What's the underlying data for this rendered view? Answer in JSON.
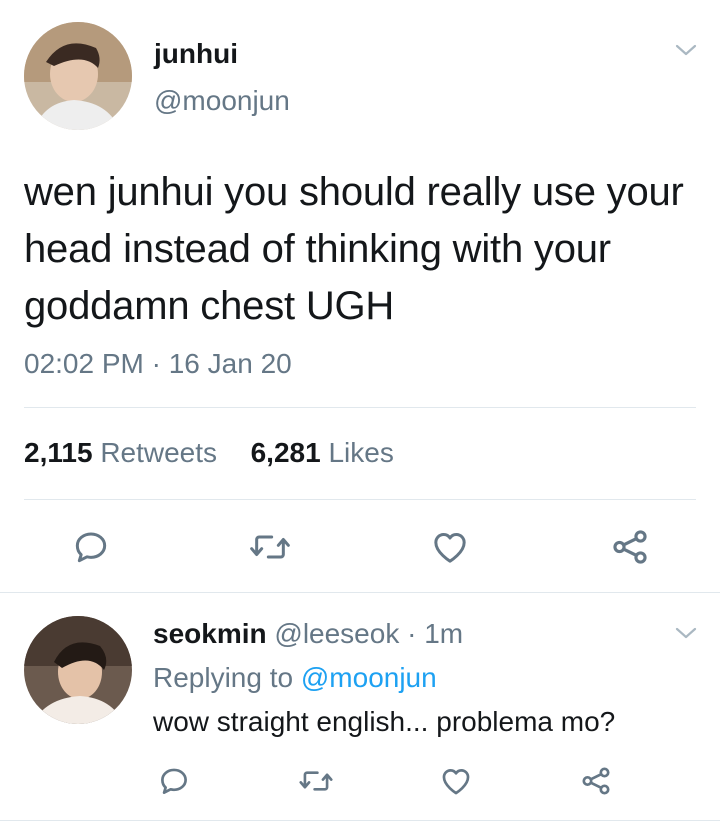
{
  "main_tweet": {
    "display_name": "junhui",
    "handle": "@moonjun",
    "text": "wen junhui you should really use your head instead of thinking with your goddamn chest UGH",
    "timestamp": "02:02 PM · 16 Jan 20",
    "retweets_count": "2,115",
    "retweets_label": "Retweets",
    "likes_count": "6,281",
    "likes_label": "Likes"
  },
  "reply": {
    "display_name": "seokmin",
    "handle": "@leeseok",
    "time": "· 1m",
    "replying_prefix": "Replying to",
    "replying_handle": "@moonjun",
    "text": "wow straight english... problema mo?"
  },
  "icons": [
    "chevron-down-icon",
    "reply-icon",
    "retweet-icon",
    "like-icon",
    "share-icon"
  ],
  "colors": {
    "accent": "#1da1f2",
    "secondary_text": "#657786",
    "divider": "#e1e8ed",
    "icon": "#657786"
  }
}
